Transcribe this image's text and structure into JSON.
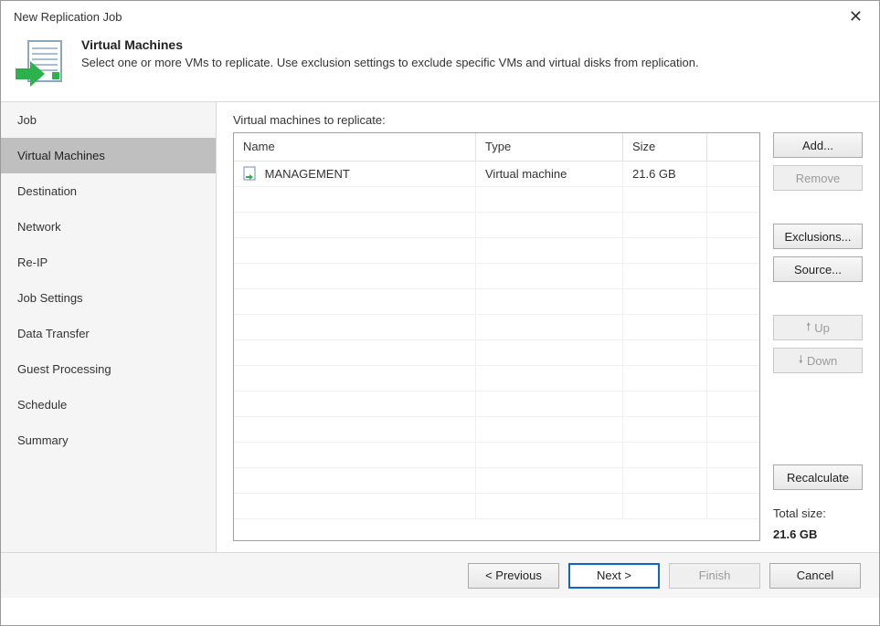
{
  "window": {
    "title": "New Replication Job"
  },
  "header": {
    "title": "Virtual Machines",
    "description": "Select one or more VMs to replicate. Use exclusion settings to exclude specific VMs and virtual disks from replication."
  },
  "sidebar": {
    "items": [
      {
        "label": "Job",
        "active": false
      },
      {
        "label": "Virtual Machines",
        "active": true
      },
      {
        "label": "Destination",
        "active": false
      },
      {
        "label": "Network",
        "active": false
      },
      {
        "label": "Re-IP",
        "active": false
      },
      {
        "label": "Job Settings",
        "active": false
      },
      {
        "label": "Data Transfer",
        "active": false
      },
      {
        "label": "Guest Processing",
        "active": false
      },
      {
        "label": "Schedule",
        "active": false
      },
      {
        "label": "Summary",
        "active": false
      }
    ]
  },
  "main": {
    "section_label": "Virtual machines to replicate:",
    "columns": {
      "name": "Name",
      "type": "Type",
      "size": "Size"
    },
    "rows": [
      {
        "name": "MANAGEMENT",
        "type": "Virtual machine",
        "size": "21.6 GB"
      }
    ],
    "buttons": {
      "add": "Add...",
      "remove": "Remove",
      "exclusions": "Exclusions...",
      "source": "Source...",
      "up": "Up",
      "down": "Down",
      "recalculate": "Recalculate"
    },
    "total_label": "Total size:",
    "total_value": "21.6 GB"
  },
  "footer": {
    "previous": "< Previous",
    "next": "Next >",
    "finish": "Finish",
    "cancel": "Cancel"
  }
}
